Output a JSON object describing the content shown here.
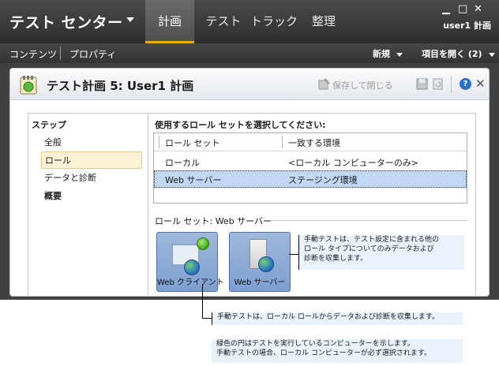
{
  "app": {
    "title": "テスト センター",
    "user": "user1 計画"
  },
  "topnav": {
    "tabs": [
      {
        "label": "計画",
        "active": true
      },
      {
        "label": "テスト",
        "active": false
      },
      {
        "label": "トラック",
        "active": false
      },
      {
        "label": "整理",
        "active": false
      }
    ]
  },
  "window_controls": {
    "minimize": "▁",
    "maximize": "□",
    "close": "✕"
  },
  "subnav": {
    "contents": "コンテンツ",
    "properties": "プロパティ",
    "new_label": "新規",
    "open_items_label": "項目を開く (2)"
  },
  "panel": {
    "title": "テスト計画 5: User1 計画",
    "save_close_label": "保存して閉じる",
    "help_label": "?",
    "close_label": "✕"
  },
  "steps": {
    "title": "ステップ",
    "items": [
      {
        "label": "全般",
        "selected": false,
        "bold": false
      },
      {
        "label": "ロール",
        "selected": true,
        "bold": false
      },
      {
        "label": "データと診断",
        "selected": false,
        "bold": false
      },
      {
        "label": "概要",
        "selected": false,
        "bold": true
      }
    ]
  },
  "roles": {
    "prompt": "使用するロール セットを選択してください:",
    "columns": [
      "ロール セット",
      "一致する環境"
    ],
    "rows": [
      {
        "role_set": "ローカル",
        "environment": "<ローカル コンピューターのみ>",
        "selected": false
      },
      {
        "role_set": "Web サーバー",
        "environment": "ステージング環境",
        "selected": true
      }
    ],
    "roleset_label": "ロール セット: Web サーバー",
    "cards": [
      {
        "label": "Web クライアント",
        "icon": "client-computer-icon",
        "selected": true
      },
      {
        "label": "Web サーバー",
        "icon": "server-icon",
        "selected": false
      }
    ]
  },
  "callouts": {
    "server_note": "手動テストは、テスト設定に含まれる他の\nロール タイプについてのみデータおよび\n診断を収集します。",
    "client_note": "手動テストは、ローカル ロールからデータおよび診断を収集します。",
    "green_circle_note_1": "緑色の円はテストを実行しているコンピューターを示します。",
    "green_circle_note_2": "手動テストの場合、ローカル コンピューターが必ず選択されます。"
  },
  "colors": {
    "topbar": "#3a3a3a",
    "active_tab_accent": "#f0a800",
    "selected_row": "#c0d8f4",
    "selected_step": "#fbf2d8",
    "role_card": "#8fadd8"
  }
}
